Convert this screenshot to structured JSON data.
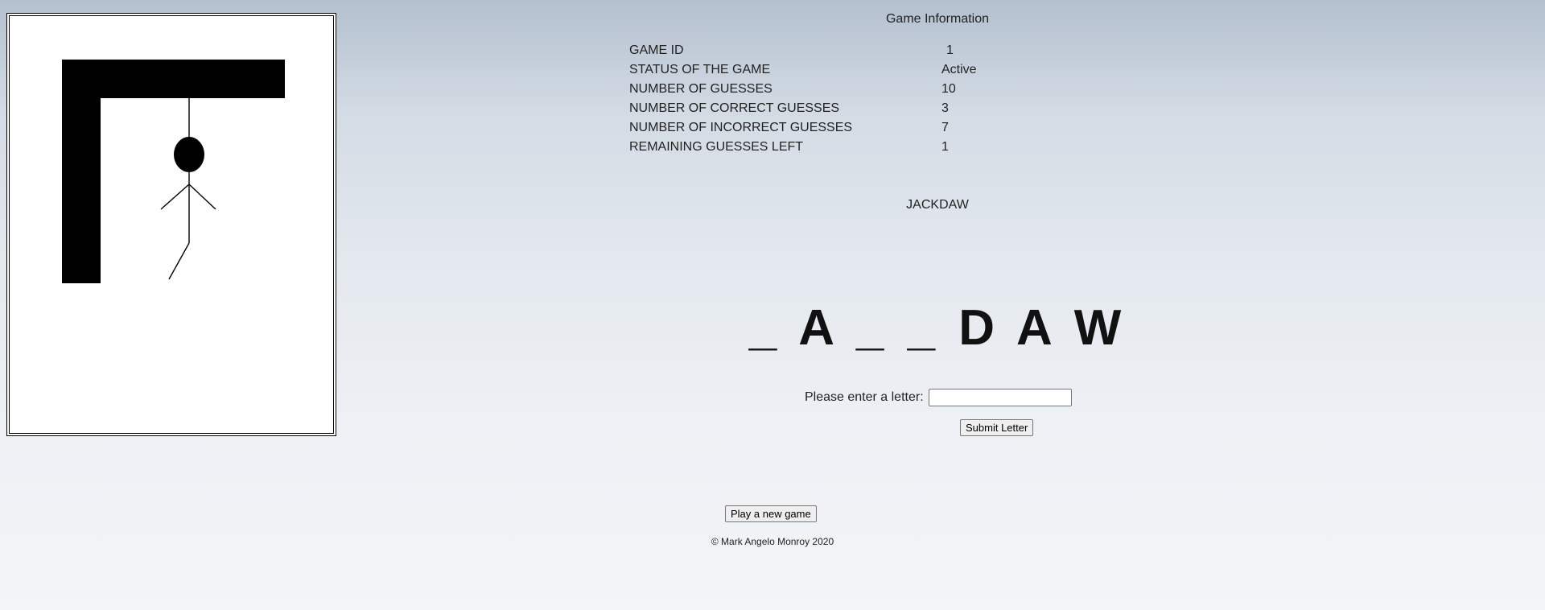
{
  "info": {
    "title": "Game Information",
    "rows": [
      {
        "label": "GAME ID",
        "value": "1"
      },
      {
        "label": "STATUS OF THE GAME",
        "value": "Active"
      },
      {
        "label": "NUMBER OF GUESSES",
        "value": "10"
      },
      {
        "label": "NUMBER OF CORRECT GUESSES",
        "value": "3"
      },
      {
        "label": "NUMBER OF INCORRECT GUESSES",
        "value": "7"
      },
      {
        "label": "REMAINING GUESSES LEFT",
        "value": "1"
      }
    ]
  },
  "word": {
    "revealed": "JACKDAW",
    "masked": "_ A _ _ D A W"
  },
  "form": {
    "prompt": "Please enter a letter:",
    "input_value": "",
    "submit_label": "Submit Letter"
  },
  "new_game_label": "Play a new game",
  "footer": "© Mark Angelo Monroy 2020"
}
